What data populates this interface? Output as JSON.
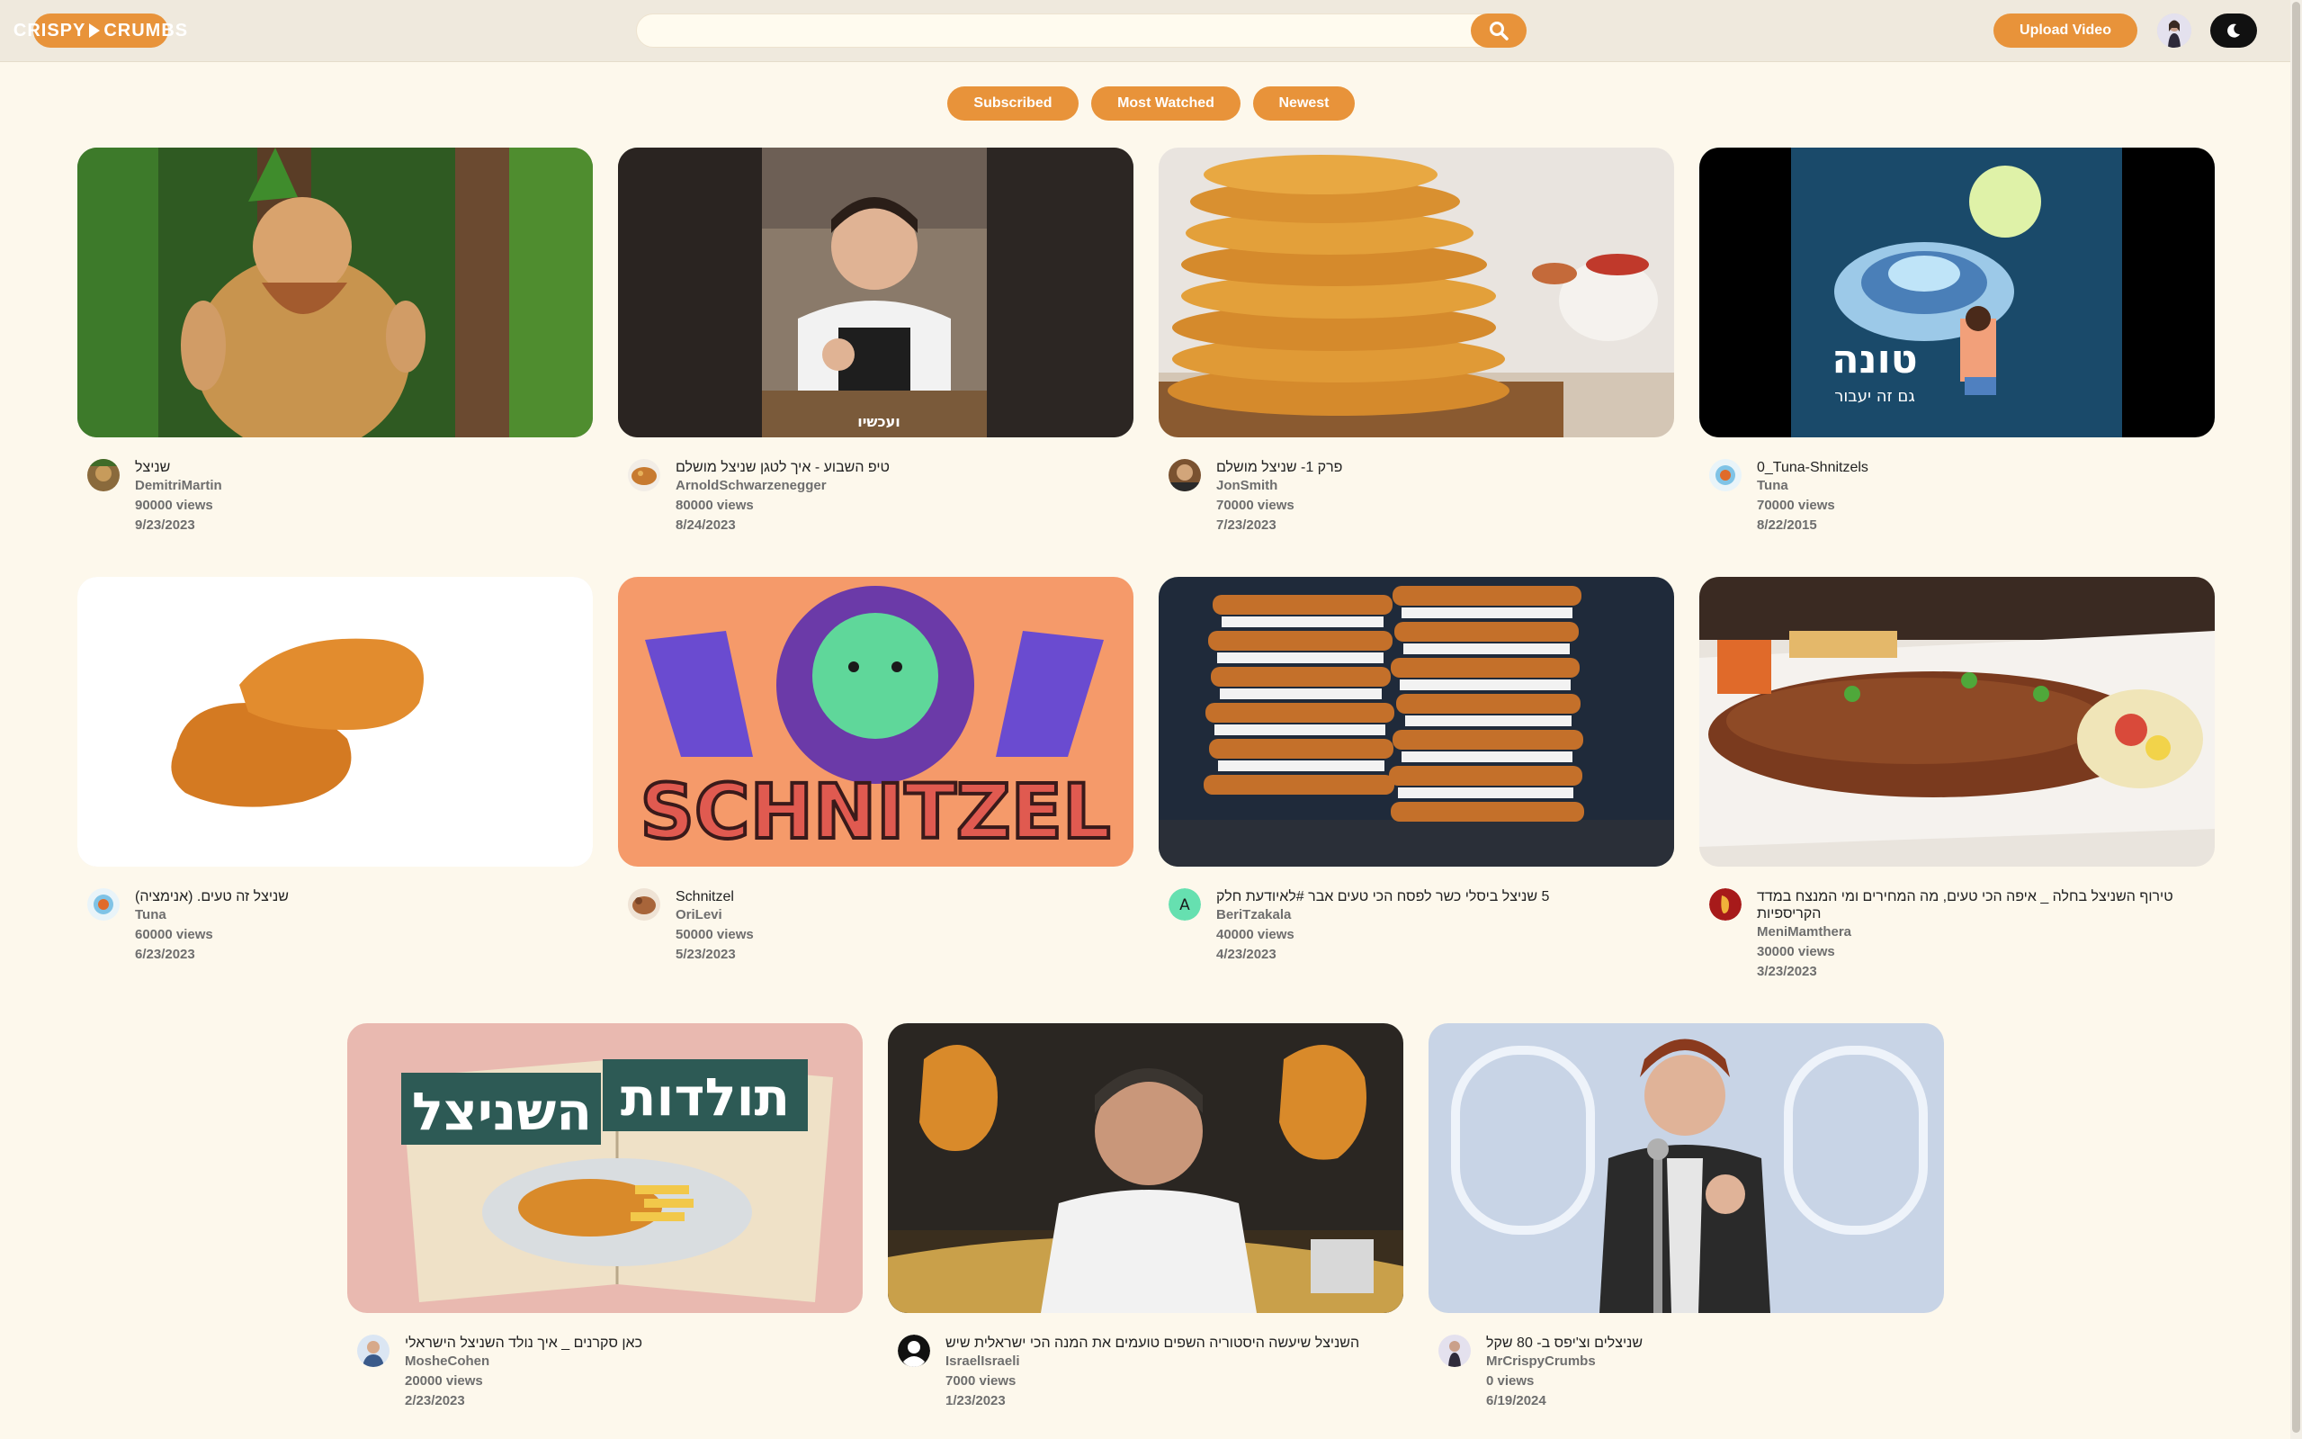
{
  "app": {
    "logo_left": "CRISPY",
    "logo_right": "CRUMBS"
  },
  "header": {
    "search_placeholder": "",
    "upload_label": "Upload Video"
  },
  "filters": [
    "Subscribed",
    "Most Watched",
    "Newest"
  ],
  "colors": {
    "accent": "#e8933a",
    "page_bg": "#fdf8ec",
    "topbar_bg": "#efe9dd"
  },
  "videos": [
    {
      "title": "שניצל",
      "channel": "DemitriMartin",
      "views": "90000 views",
      "date": "9/23/2023"
    },
    {
      "title": "טיפ השבוע - איך לטגן שניצל מושלם",
      "channel": "ArnoldSchwarzenegger",
      "views": "80000 views",
      "date": "8/24/2023"
    },
    {
      "title": "פרק 1- שניצל מושלם",
      "channel": "JonSmith",
      "views": "70000 views",
      "date": "7/23/2023"
    },
    {
      "title": "0_Tuna-Shnitzels",
      "channel": "Tuna",
      "views": "70000 views",
      "date": "8/22/2015",
      "thumb_text": "טונה",
      "thumb_sub": "גם זה יעבור"
    },
    {
      "title": "שניצל זה טעים. (אנימציה)",
      "channel": "Tuna",
      "views": "60000 views",
      "date": "6/23/2023"
    },
    {
      "title": "Schnitzel",
      "channel": "OriLevi",
      "views": "50000 views",
      "date": "5/23/2023",
      "thumb_text": "SCHNITZEL"
    },
    {
      "title": "5 שניצל ביסלי כשר לפסח הכי טעים אבר #לאיודעת חלק",
      "channel": "BeriTzakala",
      "views": "40000 views",
      "date": "4/23/2023",
      "avatar_letter": "A"
    },
    {
      "title": "טירוף השניצל בחלה _ איפה הכי טעים, מה המחירים ומי המנצח במדד הקריספיות",
      "channel": "MeniMamthera",
      "views": "30000 views",
      "date": "3/23/2023"
    },
    {
      "title": "כאן סקרנים _ איך נולד השניצל הישראלי",
      "channel": "MosheCohen",
      "views": "20000 views",
      "date": "2/23/2023",
      "thumb_text_1": "תולדות",
      "thumb_text_2": "השניצל"
    },
    {
      "title": "השניצל שיעשה היסטוריה השפים טועמים את המנה הכי ישראלית שיש",
      "channel": "IsraelIsraeli",
      "views": "7000 views",
      "date": "1/23/2023"
    },
    {
      "title": "שניצלים וצ'יפס ב- 80 שקל",
      "channel": "MrCrispyCrumbs",
      "views": "0 views",
      "date": "6/19/2024"
    }
  ],
  "icons": {
    "search": "search-icon",
    "theme": "moon-icon"
  }
}
